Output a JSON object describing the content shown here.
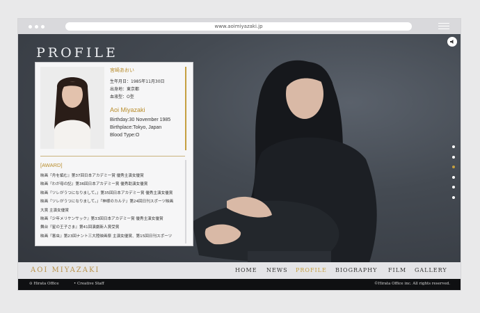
{
  "browser": {
    "url": "www.aoimiyazaki.jp"
  },
  "hero": {
    "heading": "PROFILE"
  },
  "profile": {
    "jp_name": "宮崎あおい",
    "jp_birthday": "生年月日：1985年11月30日",
    "jp_birthplace": "出身地：東京都",
    "jp_blood": "血液型：O型",
    "en_name": "Aoi Miyazaki",
    "en_birthday": "Birthday:30 November 1985",
    "en_birthplace": "Birthplace:Tokyo, Japan",
    "en_blood": "Blood Type:O",
    "award_title": "[AWARD]",
    "awards": [
      "映画『舟を編む』第37回日本アカデミー賞 優秀主演女優賞",
      "映画『わが母の記』第36回日本アカデミー賞 優秀助演女優賞",
      "映画『ツレがうつになりまして。』第35回日本アカデミー賞 優秀主演女優賞",
      "映画『ツレがうつになりまして。』『神様のカルテ』第24回日刊スポーツ映画",
      "大賞 主演女優賞",
      "映画『少年メリケンサック』第33回日本アカデミー賞 優秀主演女優賞",
      "舞台『星の王子さま』第41回演劇新人賞受賞",
      "映画『害虫』第23回ナント三大陸映画祭 主演女優賞、第15回日刊スポーツ"
    ]
  },
  "nav": {
    "logo": "AOI MIYAZAKI",
    "items": [
      "HOME",
      "NEWS",
      "PROFILE",
      "BIOGRAPHY",
      "FILM",
      "GALLERY"
    ],
    "active": "PROFILE"
  },
  "footer": {
    "left_1": "Hirata Office",
    "left_2": "Creative Staff",
    "copyright": "©Hirata Office inc. All rights reserved."
  },
  "colors": {
    "accent": "#c59f3f",
    "footer_bg": "#0f1012",
    "stage_bg": "#444a52"
  }
}
